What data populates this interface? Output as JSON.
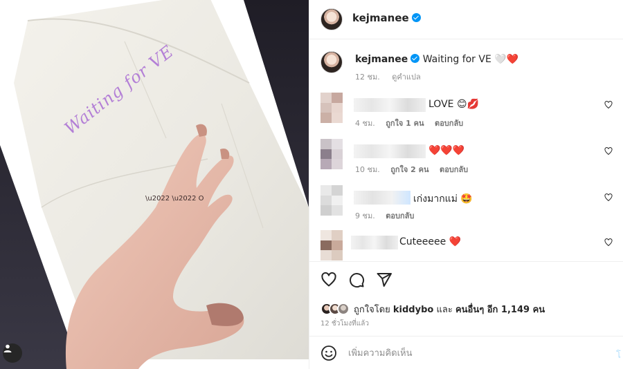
{
  "header": {
    "username": "kejmanee"
  },
  "photo": {
    "handwriting": "Waiting for VE"
  },
  "caption": {
    "username": "kejmanee",
    "text": "Waiting for VE",
    "emoji": "🤍❤️",
    "time": "12 ชม.",
    "translate": "ดูคำแปล"
  },
  "comments": [
    {
      "text": "LOVE 😊💋",
      "time": "4 ชม.",
      "likes": "ถูกใจ 1 คน",
      "reply": "ตอบกลับ"
    },
    {
      "text": "❤️❤️❤️",
      "time": "10 ชม.",
      "likes": "ถูกใจ 2 คน",
      "reply": "ตอบกลับ"
    },
    {
      "text": "เก่งมากแม่ 🤩",
      "time": "9 ชม.",
      "likes": "",
      "reply": "ตอบกลับ"
    },
    {
      "text": "Cuteeeee ❤️",
      "time": "",
      "likes": "",
      "reply": ""
    }
  ],
  "likes": {
    "prefix": "ถูกใจโดย",
    "user": "kiddybo",
    "middle": "และ",
    "others": "คนอื่นๆ อีก 1,149 คน"
  },
  "post_time": "12 ชั่วโมงที่แล้ว",
  "add_comment": {
    "placeholder": "เพิ่มความคิดเห็น",
    "post_label": "โ"
  },
  "icons": {
    "like": "heart-icon",
    "comment": "comment-icon",
    "share": "send-icon",
    "emoji": "emoji-icon",
    "tag": "user-tag-icon"
  },
  "colors": {
    "verified": "#0095f6",
    "heart": "#ed4956",
    "muted": "#8e8e8e"
  }
}
